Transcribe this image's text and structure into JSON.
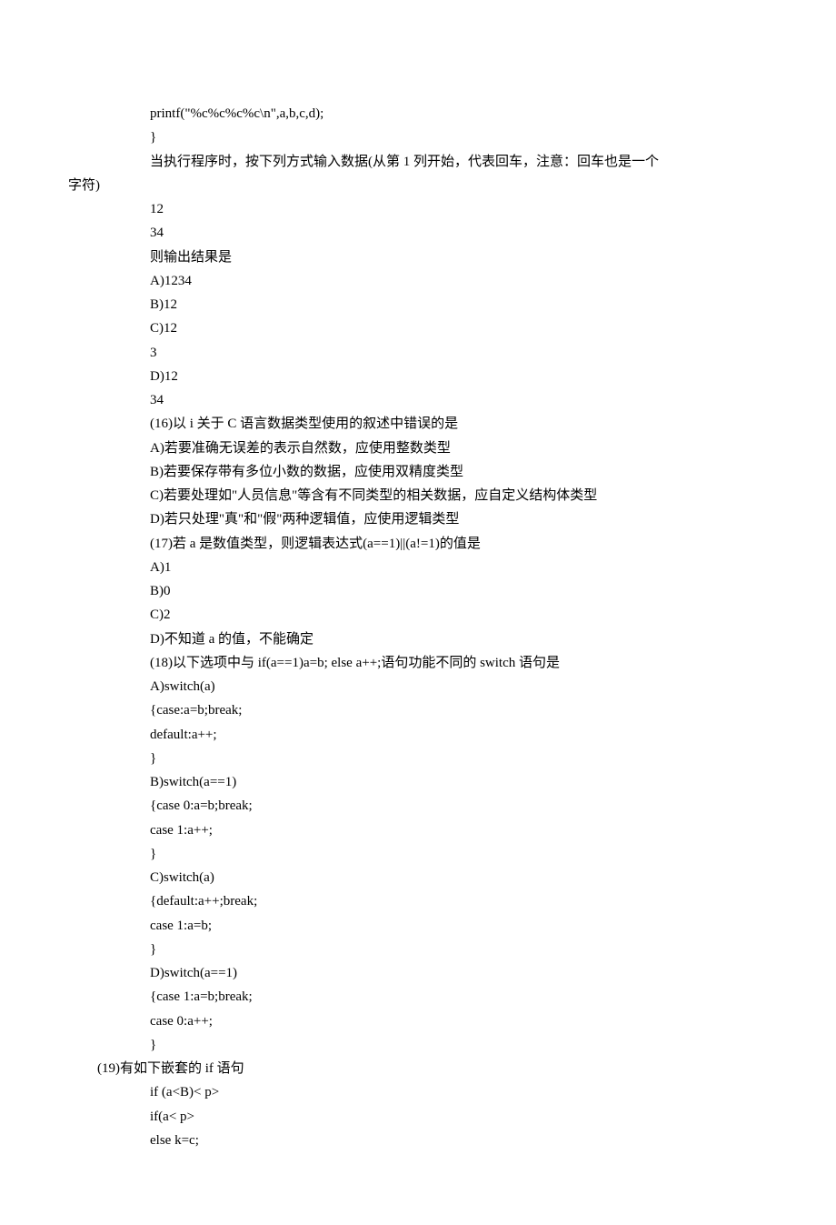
{
  "lines": [
    {
      "cls": "line",
      "t": "printf(\"%c%c%c%c\\n\",a,b,c,d);"
    },
    {
      "cls": "line",
      "t": "}"
    },
    {
      "cls": "line",
      "t": "当执行程序时，按下列方式输入数据(从第 1 列开始，代表回车，注意：回车也是一个"
    },
    {
      "cls": "line-far-left",
      "t": "字符)"
    },
    {
      "cls": "line",
      "t": "12"
    },
    {
      "cls": "line",
      "t": "34"
    },
    {
      "cls": "line",
      "t": "则输出结果是"
    },
    {
      "cls": "line",
      "t": "A)1234"
    },
    {
      "cls": "line",
      "t": "B)12"
    },
    {
      "cls": "line",
      "t": "C)12"
    },
    {
      "cls": "line",
      "t": "3"
    },
    {
      "cls": "line",
      "t": "D)12"
    },
    {
      "cls": "line",
      "t": "34"
    },
    {
      "cls": "line",
      "t": "(16)以 i 关于 C 语言数据类型使用的叙述中错误的是"
    },
    {
      "cls": "line",
      "t": "A)若要准确无误差的表示自然数，应使用整数类型"
    },
    {
      "cls": "line",
      "t": "B)若要保存带有多位小数的数据，应使用双精度类型"
    },
    {
      "cls": "line",
      "t": "C)若要处理如\"人员信息\"等含有不同类型的相关数据，应自定义结构体类型"
    },
    {
      "cls": "line",
      "t": "D)若只处理\"真\"和\"假\"两种逻辑值，应使用逻辑类型"
    },
    {
      "cls": "line",
      "t": "(17)若 a 是数值类型，则逻辑表达式(a==1)||(a!=1)的值是"
    },
    {
      "cls": "line",
      "t": "A)1"
    },
    {
      "cls": "line",
      "t": "B)0"
    },
    {
      "cls": "line",
      "t": "C)2"
    },
    {
      "cls": "line",
      "t": "D)不知道 a 的值，不能确定"
    },
    {
      "cls": "line",
      "t": "(18)以下选项中与 if(a==1)a=b; else a++;语句功能不同的 switch 语句是"
    },
    {
      "cls": "line",
      "t": "A)switch(a)"
    },
    {
      "cls": "line",
      "t": "{case:a=b;break;"
    },
    {
      "cls": "line",
      "t": "default:a++;"
    },
    {
      "cls": "line",
      "t": "}"
    },
    {
      "cls": "line",
      "t": "B)switch(a==1)"
    },
    {
      "cls": "line",
      "t": "{case 0:a=b;break;"
    },
    {
      "cls": "line",
      "t": "case 1:a++;"
    },
    {
      "cls": "line",
      "t": "}"
    },
    {
      "cls": "line",
      "t": "C)switch(a)"
    },
    {
      "cls": "line",
      "t": "{default:a++;break;"
    },
    {
      "cls": "line",
      "t": "case 1:a=b;"
    },
    {
      "cls": "line",
      "t": "}"
    },
    {
      "cls": "line",
      "t": "D)switch(a==1)"
    },
    {
      "cls": "line",
      "t": "{case 1:a=b;break;"
    },
    {
      "cls": "line",
      "t": "case 0:a++;"
    },
    {
      "cls": "line",
      "t": "}"
    },
    {
      "cls": "line-outdent",
      "t": "(19)有如下嵌套的 if 语句"
    },
    {
      "cls": "line",
      "t": "if (a<B)< p>"
    },
    {
      "cls": "line",
      "t": "if(a< p>"
    },
    {
      "cls": "line",
      "t": "else k=c;"
    }
  ]
}
